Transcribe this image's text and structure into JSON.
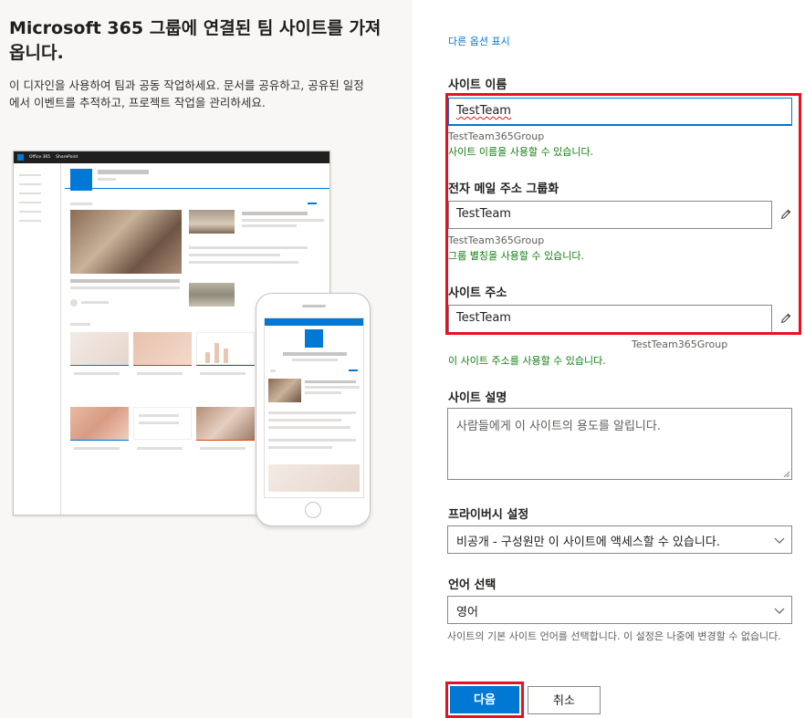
{
  "left": {
    "title": "Microsoft 365 그룹에 연결된 팀 사이트를 가져옵니다.",
    "description": "이 디자인을 사용하여 팀과 공동 작업하세요. 문서를 공유하고, 공유된 일정에서 이벤트를 추적하고, 프로젝트 작업을 관리하세요.",
    "illustration": {
      "app_name": "Office 365",
      "product_name": "SharePoint"
    }
  },
  "form": {
    "more_options_link": "다른 옵션 표시",
    "site_name": {
      "label": "사이트 이름",
      "value": "TestTeam",
      "group_hint": "TestTeam365Group",
      "status": "사이트 이름을 사용할 수 있습니다."
    },
    "group_email": {
      "label": "전자 메일 주소 그룹화",
      "value": "TestTeam",
      "hint": "TestTeam365Group",
      "status": "그룹 별칭을 사용할 수 있습니다."
    },
    "site_address": {
      "label": "사이트 주소",
      "value": "TestTeam",
      "hint": "TestTeam365Group",
      "status": "이 사이트 주소를 사용할 수 있습니다."
    },
    "site_description": {
      "label": "사이트 설명",
      "placeholder": "사람들에게 이 사이트의 용도를 알립니다."
    },
    "privacy": {
      "label": "프라이버시 설정",
      "selected": "비공개 - 구성원만 이 사이트에 액세스할 수 있습니다."
    },
    "language": {
      "label": "언어 선택",
      "selected": "영어",
      "help": "사이트의 기본 사이트 언어를 선택합니다. 이 설정은 나중에 변경할 수 없습니다."
    },
    "buttons": {
      "next": "다음",
      "cancel": "취소"
    }
  },
  "colors": {
    "accent": "#0078d4",
    "success": "#107c10",
    "highlight_border": "#e81123"
  }
}
